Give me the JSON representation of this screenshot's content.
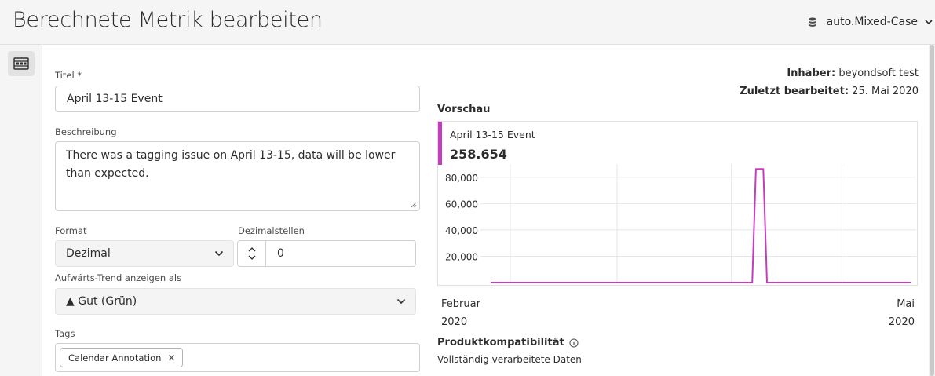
{
  "header": {
    "title": "Berechnete Metrik bearbeiten",
    "report_suite": "auto.Mixed-Case"
  },
  "form": {
    "title_label": "Titel",
    "title_required_mark": "*",
    "title_value": "April 13-15 Event",
    "description_label": "Beschreibung",
    "description_value": "There was a tagging issue on April 13-15, data will be lower than expected.",
    "format_label": "Format",
    "format_value": "Dezimal",
    "decimals_label": "Dezimalstellen",
    "decimals_value": "0",
    "trend_label": "Aufwärts-Trend anzeigen als",
    "trend_value": "▲ Gut (Grün)",
    "tags_label": "Tags",
    "tags": [
      "Calendar Annotation"
    ]
  },
  "meta": {
    "owner_label": "Inhaber:",
    "owner_value": "beyondsoft test",
    "modified_label": "Zuletzt bearbeitet:",
    "modified_value": "25. Mai 2020"
  },
  "preview": {
    "label": "Vorschau",
    "metric_name": "April 13-15 Event",
    "metric_total": "258.654",
    "accent_color": "#c53cbf"
  },
  "chart_data": {
    "type": "line",
    "series": [
      {
        "values": [
          {
            "x": "2020-02-01",
            "y": 0
          },
          {
            "x": "2020-04-12",
            "y": 0
          },
          {
            "x": "2020-04-13",
            "y": 86218
          },
          {
            "x": "2020-04-14",
            "y": 86218
          },
          {
            "x": "2020-04-15",
            "y": 86218
          },
          {
            "x": "2020-04-16",
            "y": 0
          },
          {
            "x": "2020-05-25",
            "y": 0
          }
        ]
      }
    ],
    "y_ticks": [
      "20,000",
      "40,000",
      "60,000",
      "80,000"
    ],
    "ylim": [
      0,
      90000
    ],
    "x_tick_labels": [
      {
        "month": "Februar",
        "year": "2020"
      },
      {
        "month": "Mai",
        "year": "2020"
      }
    ],
    "grid": true
  },
  "compat": {
    "title": "Produktkompatibilität",
    "text": "Vollständig verarbeitete Daten"
  }
}
